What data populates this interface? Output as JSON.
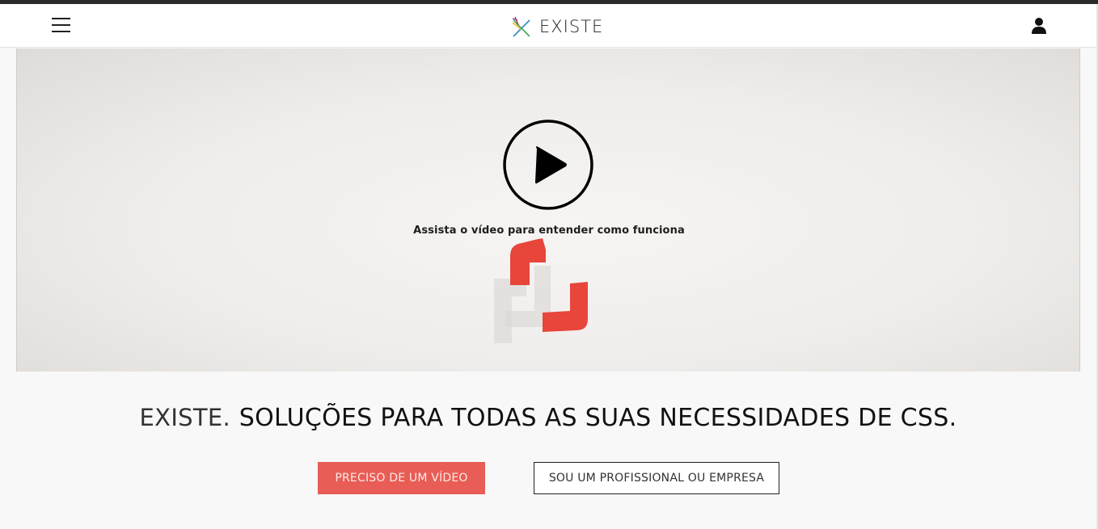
{
  "header": {
    "brand_name": "EXISTE",
    "menu_icon": "hamburger-menu-icon",
    "account_icon": "user-icon",
    "logo_colors": [
      "#e8c22c",
      "#c2263f",
      "#2c86c9",
      "#3caa5a",
      "#7b3fa0"
    ]
  },
  "video": {
    "play_icon": "play-icon",
    "caption": "Assista o vídeo para entender como funciona",
    "logo_color": "#e8453b"
  },
  "hero": {
    "brand_prefix": "EXISTE.",
    "tagline": "SOLUÇÕES PARA TODAS AS SUAS NECESSIDADES DE CSS."
  },
  "actions": {
    "primary_label": "PRECISO DE UM VÍDEO",
    "secondary_label": "SOU UM PROFISSIONAL OU EMPRESA",
    "primary_color": "#e85d55"
  }
}
